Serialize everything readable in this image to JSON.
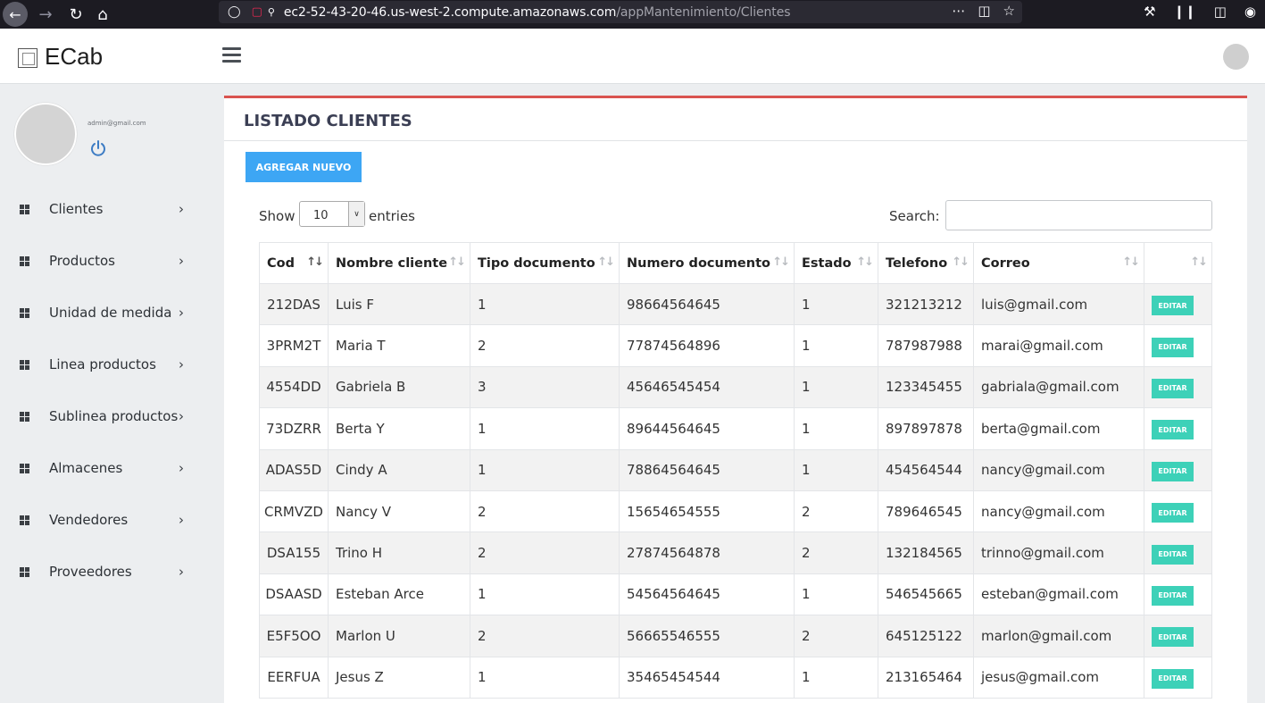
{
  "browser": {
    "url_host": "ec2-52-43-20-46.us-west-2.compute.amazonaws.com",
    "url_path": "/appMantenimiento/Clientes",
    "icons": [
      "back-icon",
      "forward-icon",
      "reload-icon",
      "home-icon",
      "shield-icon",
      "insecure-lock-icon",
      "key-icon",
      "more-icon",
      "pocket-icon",
      "star-icon",
      "wrench-icon",
      "library-icon",
      "sidebar-icon",
      "account-icon"
    ]
  },
  "header": {
    "brand": "ECab"
  },
  "sidebar": {
    "email": "admin@gmail.com",
    "items": [
      {
        "label": "Clientes"
      },
      {
        "label": "Productos"
      },
      {
        "label": "Unidad de medida"
      },
      {
        "label": "Linea productos"
      },
      {
        "label": "Sublinea productos"
      },
      {
        "label": "Almacenes"
      },
      {
        "label": "Vendedores"
      },
      {
        "label": "Proveedores"
      }
    ]
  },
  "content": {
    "title": "LISTADO CLIENTES",
    "add_button": "AGREGAR NUEVO",
    "show_label": "Show",
    "show_value": "10",
    "entries_label": "entries",
    "search_label": "Search:",
    "search_value": "",
    "accent_color": "#d9534f",
    "button_color": "#3da6f4",
    "edit_color": "#3dd1b8"
  },
  "table": {
    "columns": [
      "Cod",
      "Nombre cliente",
      "Tipo documento",
      "Numero documento",
      "Estado",
      "Telefono",
      "Correo",
      ""
    ],
    "edit_label": "EDITAR",
    "rows": [
      [
        "212DAS",
        "Luis F",
        "1",
        "98664564645",
        "1",
        "321213212",
        "luis@gmail.com"
      ],
      [
        "3PRM2T",
        "Maria T",
        "2",
        "77874564896",
        "1",
        "787987988",
        "marai@gmail.com"
      ],
      [
        "4554DD",
        "Gabriela B",
        "3",
        "45646545454",
        "1",
        "123345455",
        "gabriala@gmail.com"
      ],
      [
        "73DZRR",
        "Berta Y",
        "1",
        "89644564645",
        "1",
        "897897878",
        "berta@gmail.com"
      ],
      [
        "ADAS5D",
        "Cindy A",
        "1",
        "78864564645",
        "1",
        "454564544",
        "nancy@gmail.com"
      ],
      [
        "CRMVZD",
        "Nancy V",
        "2",
        "15654654555",
        "2",
        "789646545",
        "nancy@gmail.com"
      ],
      [
        "DSA155",
        "Trino H",
        "2",
        "27874564878",
        "2",
        "132184565",
        "trinno@gmail.com"
      ],
      [
        "DSAASD",
        "Esteban Arce",
        "1",
        "54564564645",
        "1",
        "546545665",
        "esteban@gmail.com"
      ],
      [
        "E5F5OO",
        "Marlon U",
        "2",
        "56665546555",
        "2",
        "645125122",
        "marlon@gmail.com"
      ],
      [
        "EERFUA",
        "Jesus Z",
        "1",
        "35465454544",
        "1",
        "213165464",
        "jesus@gmail.com"
      ]
    ]
  }
}
